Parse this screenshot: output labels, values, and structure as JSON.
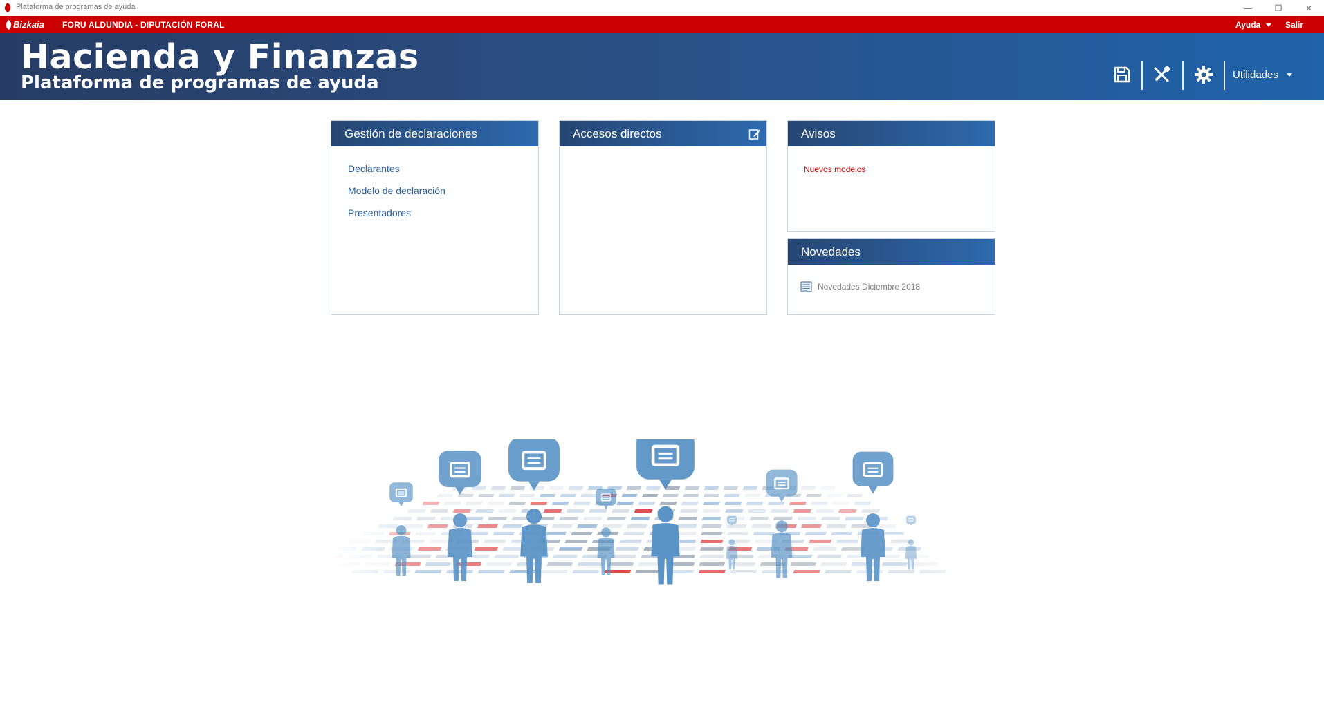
{
  "window": {
    "title": "Plataforma de programas de ayuda",
    "minimize_glyph": "—",
    "maximize_glyph": "❐",
    "close_glyph": "✕"
  },
  "topbar": {
    "logo_text": "Bizkaia",
    "organization": "FORU ALDUNDIA - DIPUTACIÓN FORAL",
    "help_label": "Ayuda",
    "exit_label": "Salir"
  },
  "header": {
    "title": "Hacienda y Finanzas",
    "subtitle": "Plataforma de programas de ayuda",
    "tools": [
      {
        "name": "save-icon"
      },
      {
        "name": "tools-icon"
      },
      {
        "name": "gear-icon"
      }
    ],
    "utilities_label": "Utilidades"
  },
  "panels": {
    "gestion": {
      "title": "Gestión de declaraciones",
      "links": [
        "Declarantes",
        "Modelo de declaración",
        "Presentadores"
      ]
    },
    "accesos": {
      "title": "Accesos directos"
    },
    "avisos": {
      "title": "Avisos",
      "items": [
        "Nuevos modelos"
      ]
    },
    "novedades": {
      "title": "Novedades",
      "items": [
        "Novedades Diciembre 2018"
      ]
    }
  },
  "colors": {
    "red_bar": "#cc0000",
    "header_dark": "#263c63",
    "header_light": "#1f63aa",
    "link": "#2a5d9c",
    "notice_red": "#cc0000",
    "illustration_blue": "#5a93c6"
  }
}
